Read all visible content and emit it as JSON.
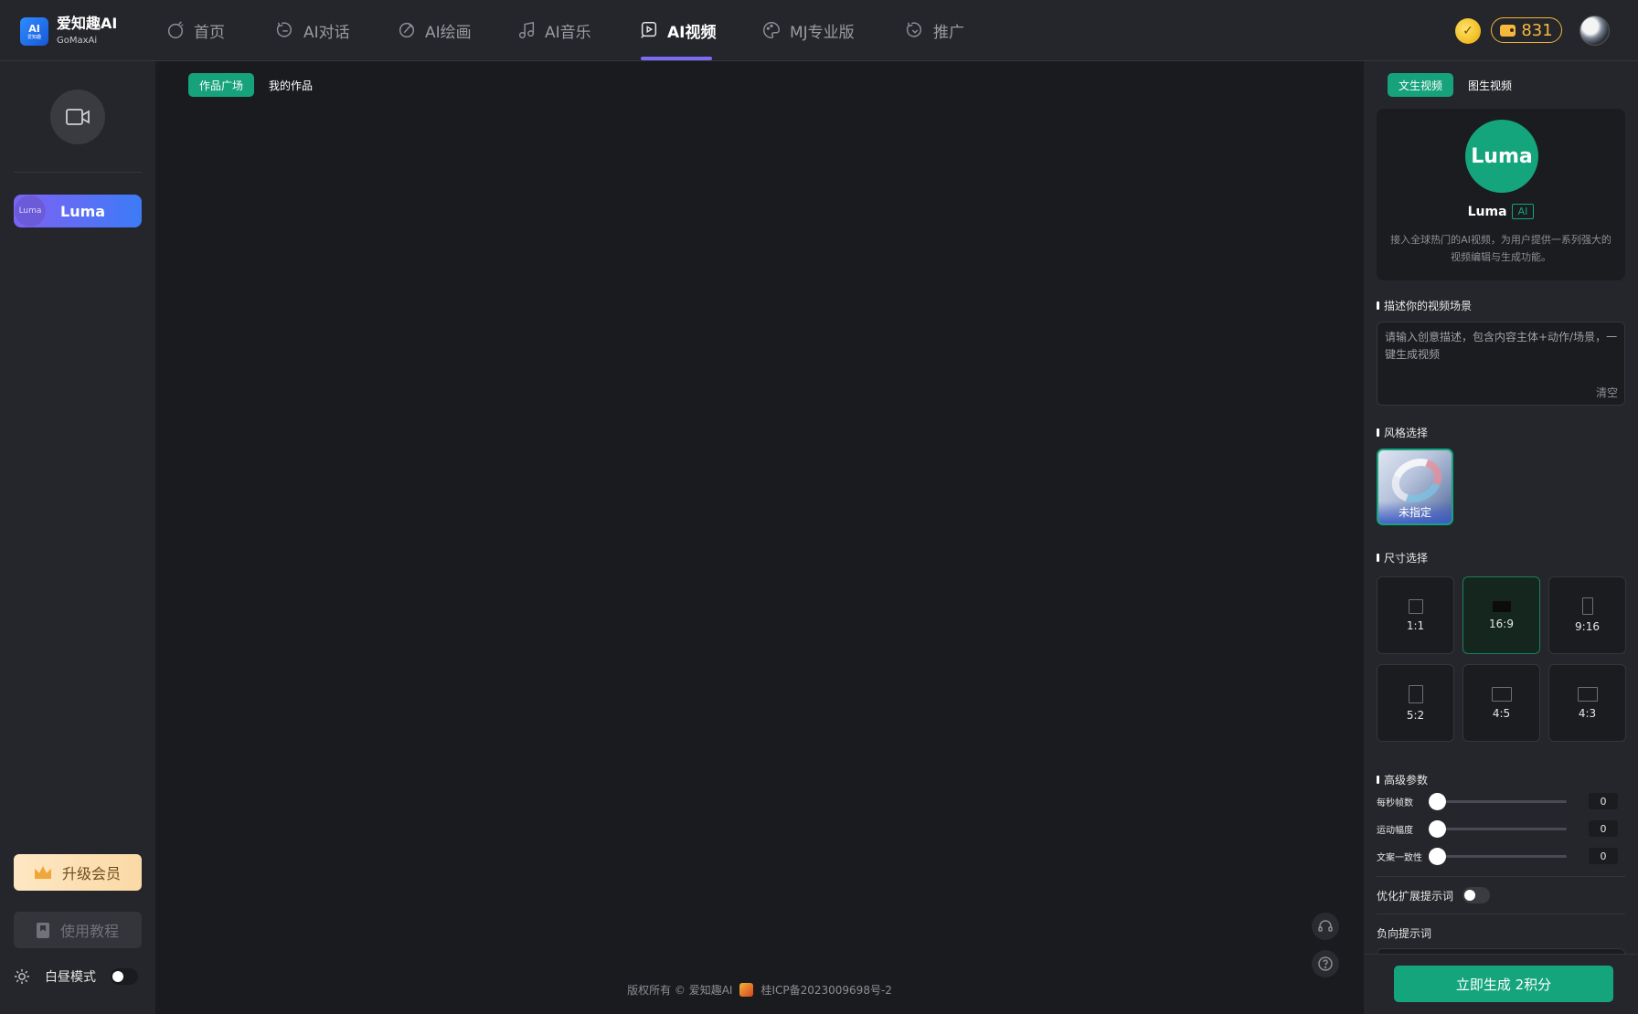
{
  "app": {
    "logo_line1": "AI",
    "logo_line2": "爱知趣",
    "name": "爱知趣AI",
    "subtitle": "GoMaxAi"
  },
  "nav": {
    "items": [
      {
        "label": "首页",
        "icon": "home-icon"
      },
      {
        "label": "AI对话",
        "icon": "chat-icon"
      },
      {
        "label": "AI绘画",
        "icon": "paint-icon"
      },
      {
        "label": "AI音乐",
        "icon": "music-icon"
      },
      {
        "label": "AI视频",
        "icon": "video-play-icon",
        "active": true
      },
      {
        "label": "MJ专业版",
        "icon": "palette-icon"
      },
      {
        "label": "推广",
        "icon": "share-icon"
      }
    ]
  },
  "header": {
    "points": "831"
  },
  "sidebar": {
    "model_label": "Luma",
    "model_logo_text": "Luma",
    "upgrade_label": "升级会员",
    "tutorial_label": "使用教程",
    "day_mode_label": "白昼模式"
  },
  "main": {
    "tabs": [
      {
        "label": "作品广场",
        "active": true
      },
      {
        "label": "我的作品",
        "active": false
      }
    ],
    "footer_copyright": "版权所有 © 爱知趣AI",
    "footer_icp": "桂ICP备2023009698号-2"
  },
  "panel": {
    "tabs": [
      {
        "label": "文生视频",
        "active": true
      },
      {
        "label": "图生视频",
        "active": false
      }
    ],
    "model_logo_text": "Luma",
    "model_name": "Luma",
    "model_badge": "AI",
    "model_desc": "接入全球热门的AI视频，为用户提供一系列强大的视频编辑与生成功能。",
    "prompt_title": "描述你的视频场景",
    "prompt_placeholder": "请输入创意描述，包含内容主体+动作/场景，一键生成视频",
    "clear_label": "清空",
    "style_title": "风格选择",
    "style_label": "未指定",
    "size_title": "尺寸选择",
    "sizes": [
      {
        "label": "1:1",
        "active": false
      },
      {
        "label": "16:9",
        "active": true
      },
      {
        "label": "9:16",
        "active": false
      },
      {
        "label": "5:2",
        "active": false
      },
      {
        "label": "4:5",
        "active": false
      },
      {
        "label": "4:3",
        "active": false
      }
    ],
    "advanced_title": "高级参数",
    "sliders": [
      {
        "label": "每秒帧数",
        "value": "0"
      },
      {
        "label": "运动幅度",
        "value": "0"
      },
      {
        "label": "文案一致性",
        "value": "0"
      }
    ],
    "optimize_label": "优化扩展提示词",
    "negative_label": "负向提示词",
    "generate_label": "立即生成 2积分"
  },
  "colors": {
    "accent_green": "#16a37b",
    "nav_underline": "#7b6cf3",
    "points_gold": "#f5b83b"
  }
}
